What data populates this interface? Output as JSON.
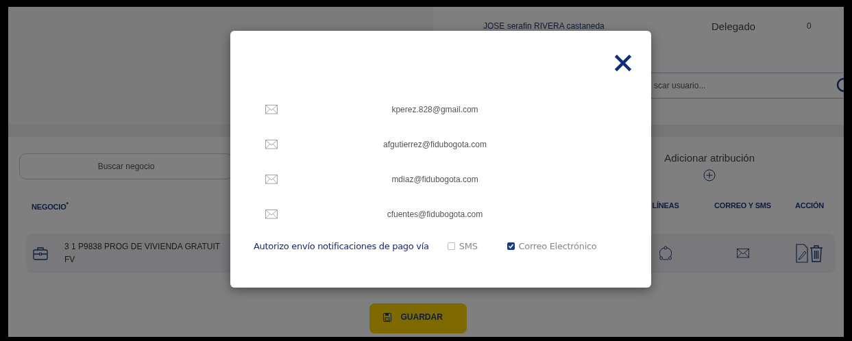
{
  "user_row": {
    "name": "JOSE serafin RIVERA castaneda",
    "role": "Delegado",
    "count": "0"
  },
  "user_search": {
    "placeholder": "scar usuario..."
  },
  "business_search": {
    "placeholder": "Buscar negocio"
  },
  "add_attribution": {
    "label": "Adicionar atribución"
  },
  "table": {
    "columns": [
      {
        "label": "NEGOCIO$^{*}$"
      },
      {
        "label": "LÍNEAS"
      },
      {
        "label": "CORREO Y SMS"
      },
      {
        "label": "ACCIÓN"
      }
    ],
    "rows": [
      {
        "business": [
          "3 1 P9838 PROG DE VIVIENDA GRATUIT",
          "FV"
        ]
      }
    ]
  },
  "save_button": {
    "label": "GUARDAR"
  },
  "modal": {
    "emails": [
      "kperez.828@gmail.com",
      "afgutierrez@fidubogota.com",
      "mdiaz@fidubogota.com",
      "cfuentes@fidubogota.com"
    ],
    "consent_label": "Autorizo envío notificaciones de pago vía",
    "options": [
      {
        "label": "SMS",
        "checked": false
      },
      {
        "label": "Correo Electrónico",
        "checked": true
      }
    ]
  }
}
